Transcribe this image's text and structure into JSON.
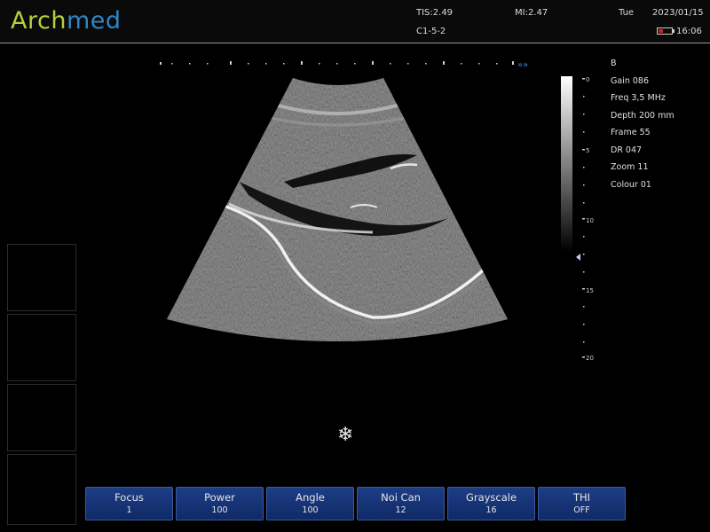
{
  "header": {
    "brand_part1": "Arch",
    "brand_part2": "med",
    "tis": "TIS:2.49",
    "mi": "MI:2.47",
    "probe": "C1-5-2",
    "day": "Tue",
    "date": "2023/01/15",
    "time": "16:06"
  },
  "params": {
    "mode": "B",
    "gain": "Gain 086",
    "freq": "Freq 3,5 MHz",
    "depth": "Depth 200 mm",
    "frame": "Frame 55",
    "dr": "DR 047",
    "zoom": "Zoom 11",
    "colour": "Colour 01"
  },
  "depth_scale": [
    "0",
    "5",
    "10",
    "15",
    "20"
  ],
  "freeze_icon": "snowflake-icon",
  "softkeys": [
    {
      "label": "Focus",
      "value": "1"
    },
    {
      "label": "Power",
      "value": "100"
    },
    {
      "label": "Angle",
      "value": "100"
    },
    {
      "label": "Noi Can",
      "value": "12"
    },
    {
      "label": "Grayscale",
      "value": "16"
    },
    {
      "label": "THI",
      "value": "OFF"
    }
  ],
  "colors": {
    "brand_green": "#b8cf3a",
    "brand_blue": "#2f86c6",
    "softkey_bg": "#1d3d85",
    "battery_low": "#d02020"
  }
}
